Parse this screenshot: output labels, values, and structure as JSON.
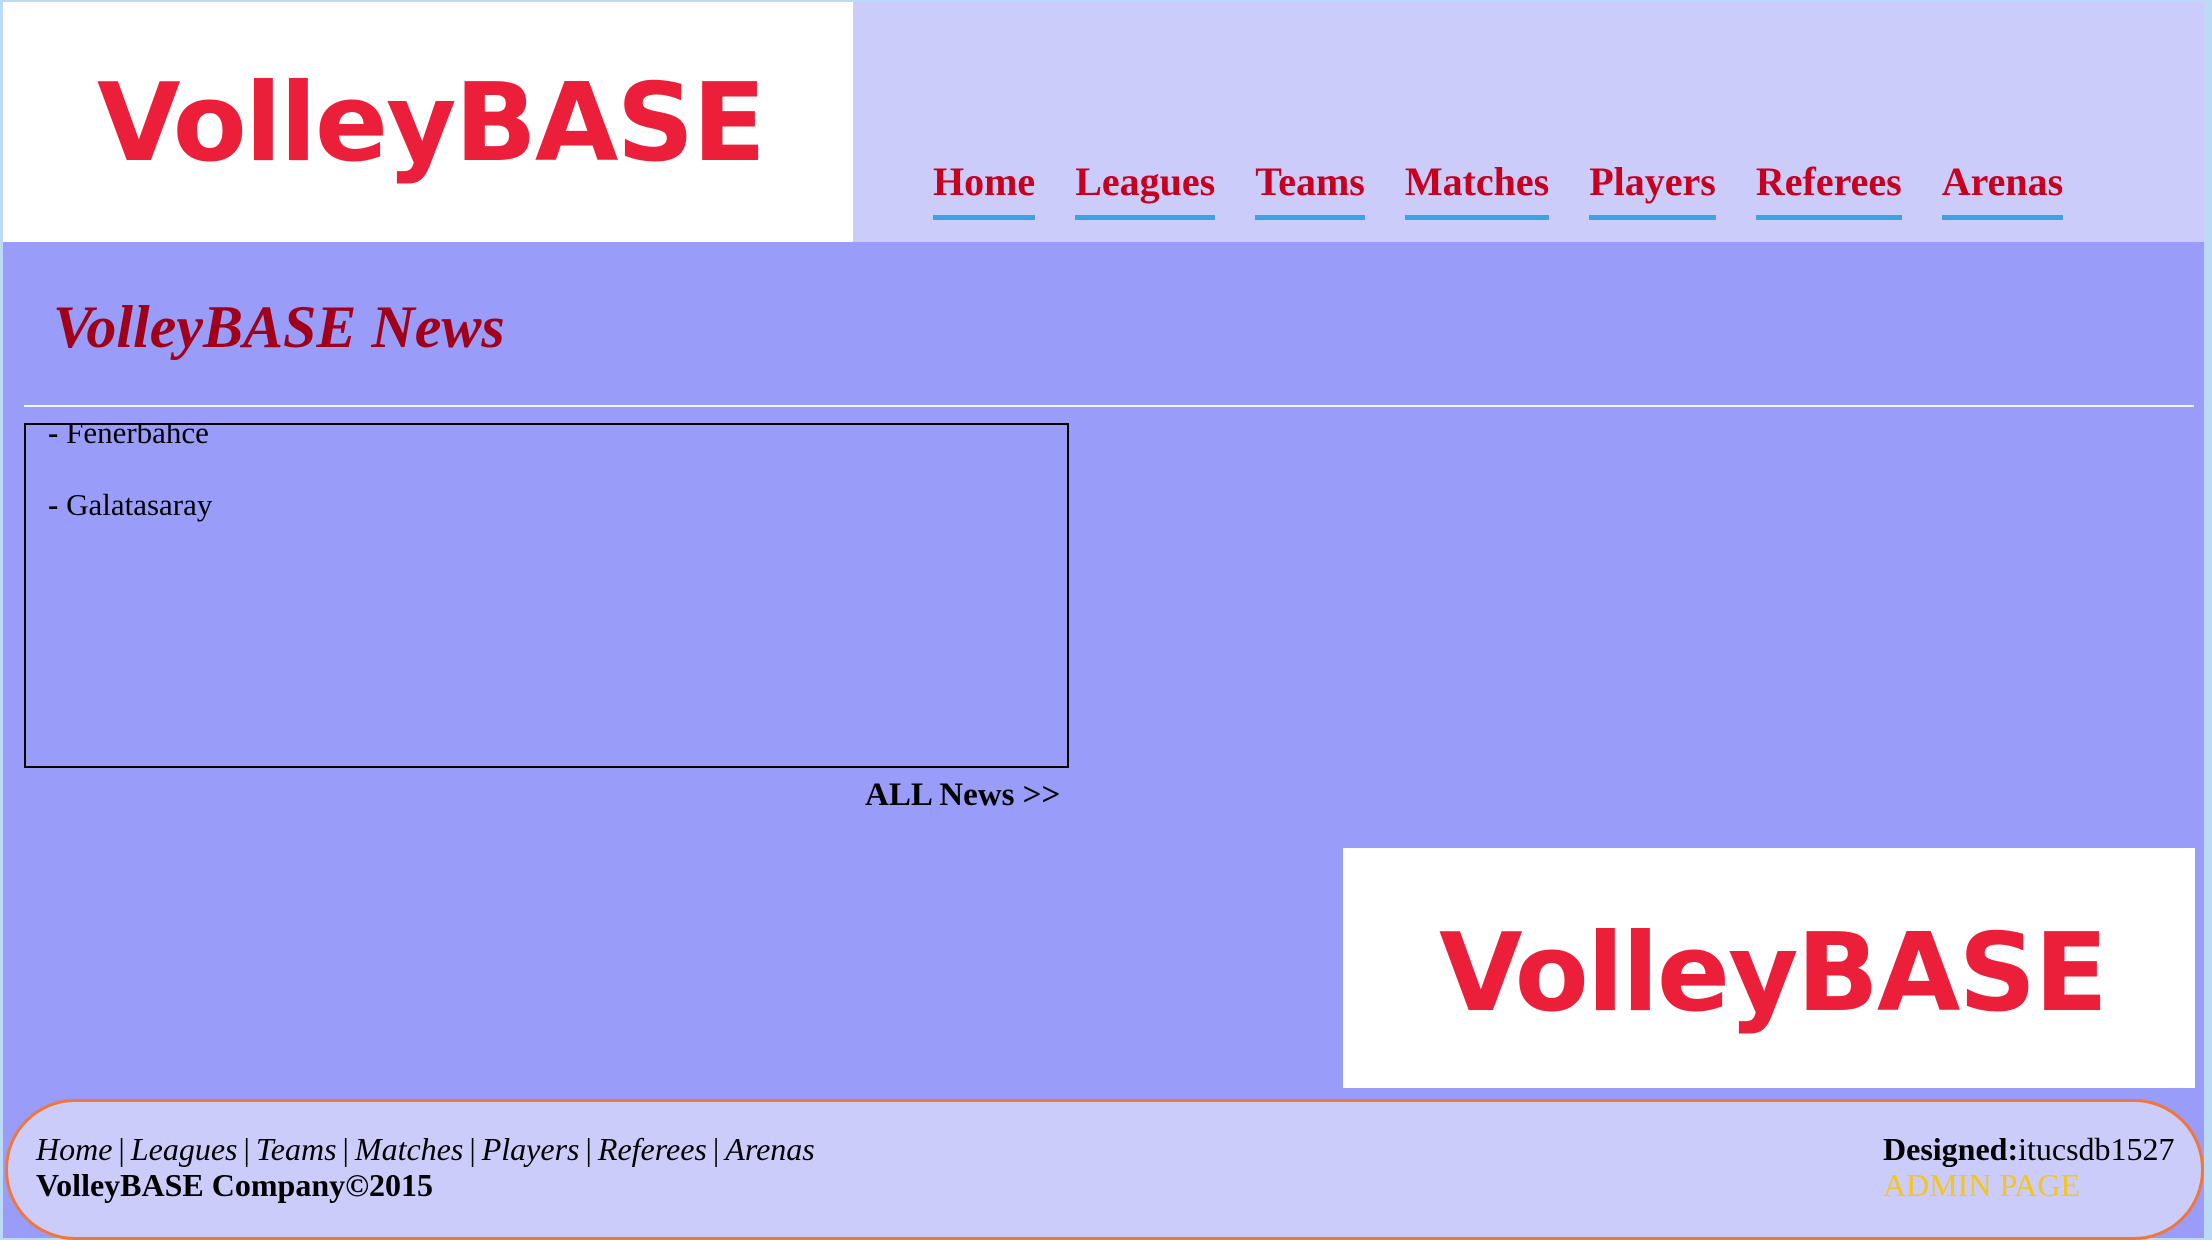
{
  "header": {
    "logo_text": "VolleyBASE",
    "nav": [
      "Home",
      "Leagues",
      "Teams",
      "Matches",
      "Players",
      "Referees",
      "Arenas"
    ]
  },
  "main": {
    "title": "VolleyBASE News",
    "news_items": [
      {
        "dash": "-",
        "text": "Fenerbahce"
      },
      {
        "dash": "-",
        "text": "Galatasaray"
      }
    ],
    "all_news_label": "ALL News >>",
    "logo_text": "VolleyBASE"
  },
  "footer": {
    "links": [
      "Home",
      "Leagues",
      "Teams",
      "Matches",
      "Players",
      "Referees",
      "Arenas"
    ],
    "separator": "|",
    "company": "VolleyBASE Company©2015",
    "designed_label": "Designed:",
    "designed_value": "itucsdb1527",
    "admin_label": "ADMIN PAGE"
  },
  "colors": {
    "page_bg": "#999cf9",
    "header_bg": "#ccccfb",
    "logo_red": "#ec1f3a",
    "nav_red": "#c80020",
    "nav_underline": "#3aa3e6",
    "footer_border": "#f0773a",
    "admin_yellow": "#f5c518"
  }
}
